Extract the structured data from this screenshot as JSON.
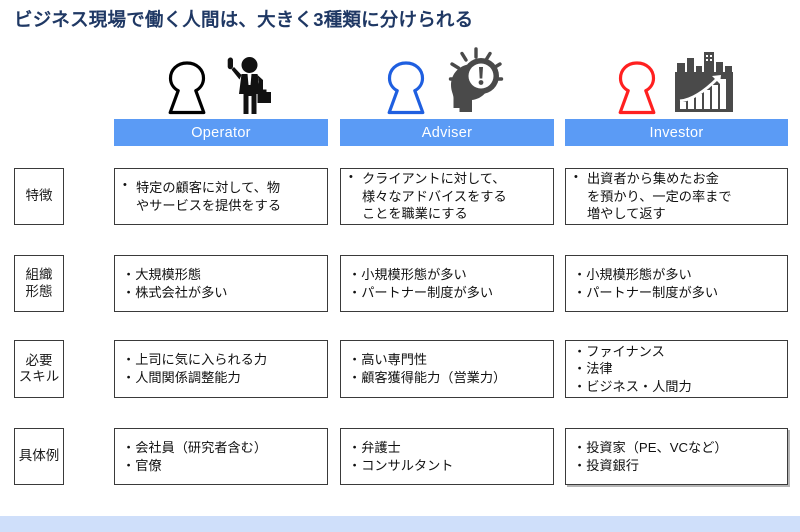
{
  "slide": {
    "title": "ビジネス現場で働く人間は、大きく3種類に分けられる",
    "title_color": "#1F3864",
    "accent_color": "#5B9BF5",
    "footer_color": "#CFDFFA"
  },
  "columns": [
    {
      "id": "operator",
      "label": "Operator",
      "keyhole_color": "#000000",
      "icon_name": "businessman-pointing-up-icon"
    },
    {
      "id": "adviser",
      "label": "Adviser",
      "keyhole_color": "#1F5FE0",
      "icon_name": "head-with-idea-exclamation-icon"
    },
    {
      "id": "investor",
      "label": "Investor",
      "keyhole_color": "#FF2020",
      "icon_name": "growth-chart-buildings-icon"
    }
  ],
  "rows": [
    {
      "id": "tokucho",
      "label": "特徴",
      "bullet_style": "dot",
      "cells": [
        {
          "lines": [
            "特定の顧客に対して、物",
            "やサービスを提供をする"
          ]
        },
        {
          "lines": [
            "クライアントに対して、",
            "様々なアドバイスをする",
            "ことを職業にする"
          ]
        },
        {
          "lines": [
            "出資者から集めたお金",
            "を預かり、一定の率まで",
            "増やして返す"
          ]
        }
      ]
    },
    {
      "id": "soshiki-keitai",
      "label": "組織\n形態",
      "label_line1": "組織",
      "label_line2": "形態",
      "bullet_style": "nakaguro",
      "cells": [
        {
          "items": [
            "大規模形態",
            "株式会社が多い"
          ]
        },
        {
          "items": [
            "小規模形態が多い",
            "パートナー制度が多い"
          ]
        },
        {
          "items": [
            "小規模形態が多い",
            "パートナー制度が多い"
          ]
        }
      ]
    },
    {
      "id": "hitsuyo-skill",
      "label": "必要\nスキル",
      "label_line1": "必要",
      "label_line2": "スキル",
      "bullet_style": "nakaguro",
      "cells": [
        {
          "items": [
            "上司に気に入られる力",
            "人間関係調整能力"
          ]
        },
        {
          "items": [
            "高い専門性",
            "顧客獲得能力（営業力）"
          ]
        },
        {
          "items": [
            "ファイナンス",
            "法律",
            "ビジネス・人間力"
          ]
        }
      ]
    },
    {
      "id": "gutairei",
      "label": "具体例",
      "bullet_style": "nakaguro",
      "cells": [
        {
          "items": [
            "会社員（研究者含む）",
            "官僚"
          ]
        },
        {
          "items": [
            "弁護士",
            "コンサルタント"
          ]
        },
        {
          "items": [
            "投資家（PE、VCなど）",
            "投資銀行"
          ]
        }
      ]
    }
  ]
}
